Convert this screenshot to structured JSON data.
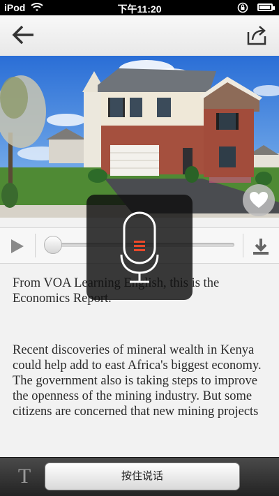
{
  "status_bar": {
    "carrier": "iPod",
    "time": "下午11:20"
  },
  "toolbar": {
    "back_icon": "arrow-left-icon",
    "share_icon": "share-icon"
  },
  "hero": {
    "favorite_icon": "heart-icon"
  },
  "player": {
    "play_icon": "play-icon",
    "progress": 0.0,
    "download_icon": "download-icon"
  },
  "voice_overlay": {
    "icon": "microphone-icon",
    "accent_color": "#e8482a"
  },
  "article": {
    "paragraphs": [
      "From VOA Learning English, this is the Economics Report.",
      "Recent discoveries of mineral wealth in Kenya could help add to east Africa's biggest economy. The government also is taking steps to improve the openness of the mining industry. But some citizens are concerned that new mining projects"
    ]
  },
  "bottom_bar": {
    "text_toggle_label": "T",
    "talk_button_label": "按住说话"
  }
}
